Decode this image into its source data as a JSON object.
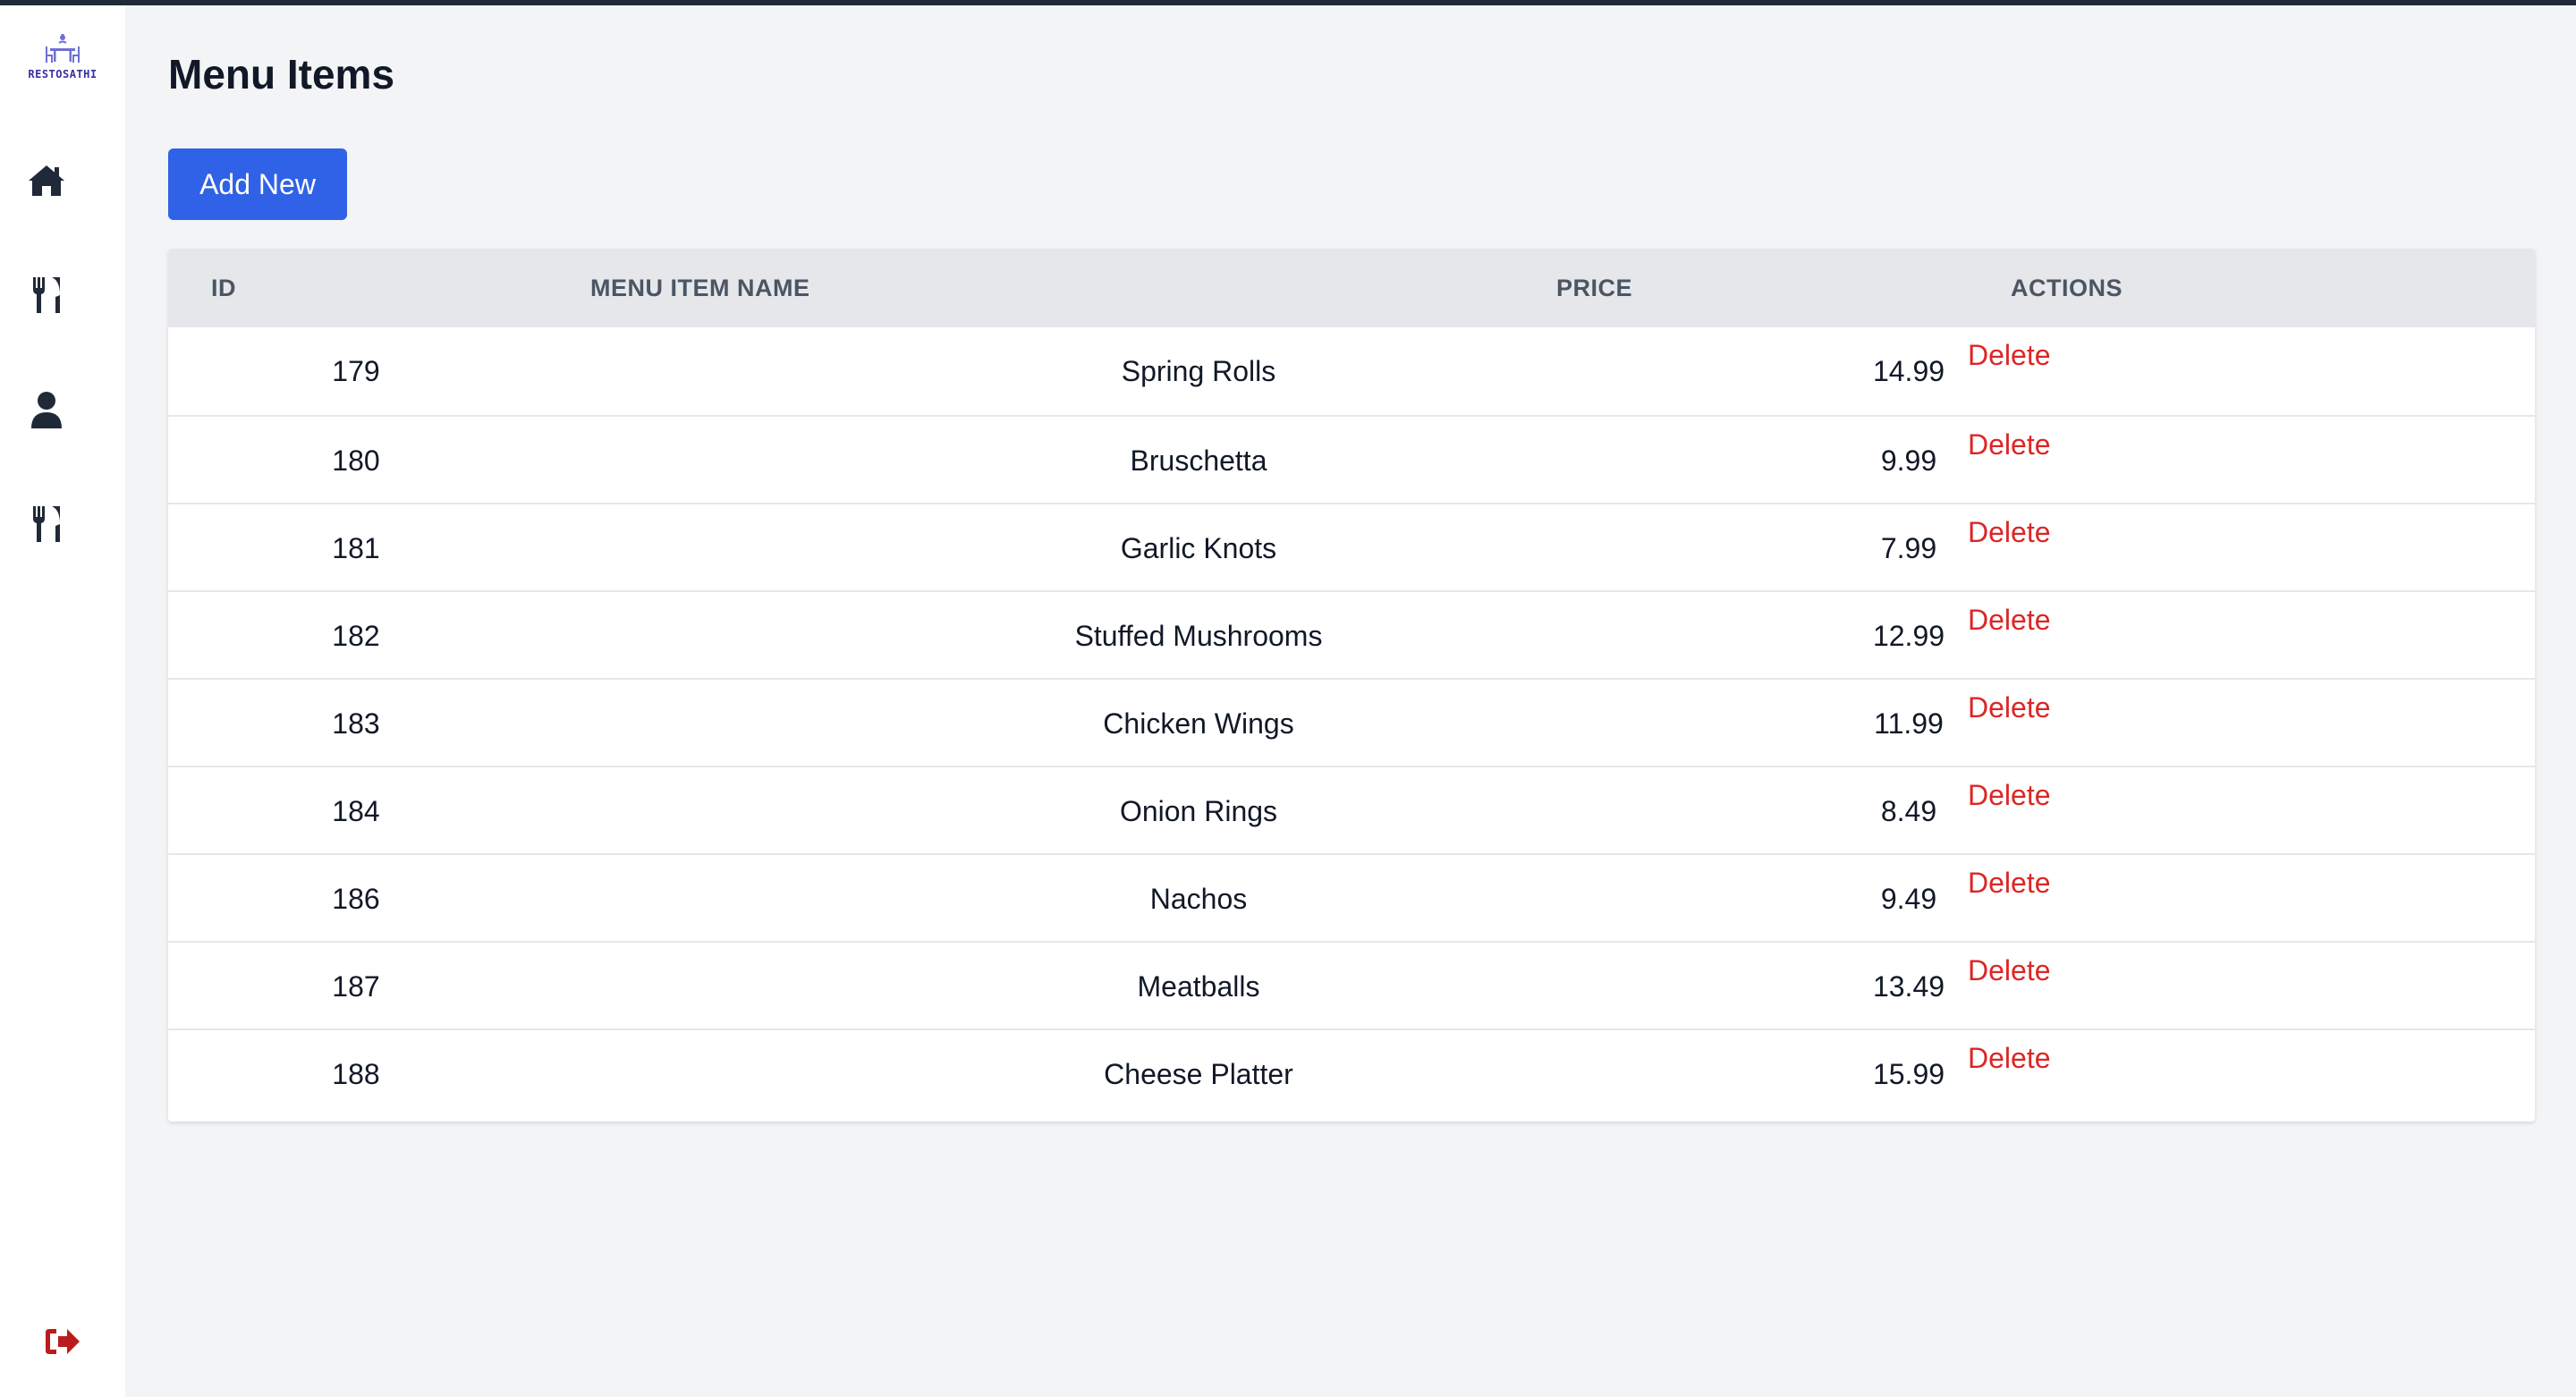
{
  "app": {
    "logo_text": "RESTOSATHI"
  },
  "colors": {
    "primary": "#2f62e6",
    "danger": "#dc2626",
    "sidebar_icon": "#1f2937",
    "logout_icon": "#b91c1c",
    "background": "#f3f4f6"
  },
  "sidebar": {
    "items": [
      {
        "icon": "home-icon"
      },
      {
        "icon": "utensils-icon"
      },
      {
        "icon": "user-icon"
      },
      {
        "icon": "utensils-icon"
      }
    ],
    "logout_icon": "logout-icon"
  },
  "page": {
    "title": "Menu Items",
    "add_button": "Add New"
  },
  "table": {
    "headers": {
      "id": "ID",
      "name": "MENU ITEM NAME",
      "price": "PRICE",
      "actions": "ACTIONS"
    },
    "rows": [
      {
        "id": "179",
        "name": "Spring Rolls",
        "price": "14.99",
        "action": "Delete"
      },
      {
        "id": "180",
        "name": "Bruschetta",
        "price": "9.99",
        "action": "Delete"
      },
      {
        "id": "181",
        "name": "Garlic Knots",
        "price": "7.99",
        "action": "Delete"
      },
      {
        "id": "182",
        "name": "Stuffed Mushrooms",
        "price": "12.99",
        "action": "Delete"
      },
      {
        "id": "183",
        "name": "Chicken Wings",
        "price": "11.99",
        "action": "Delete"
      },
      {
        "id": "184",
        "name": "Onion Rings",
        "price": "8.49",
        "action": "Delete"
      },
      {
        "id": "186",
        "name": "Nachos",
        "price": "9.49",
        "action": "Delete"
      },
      {
        "id": "187",
        "name": "Meatballs",
        "price": "13.49",
        "action": "Delete"
      },
      {
        "id": "188",
        "name": "Cheese Platter",
        "price": "15.99",
        "action": "Delete"
      }
    ]
  }
}
